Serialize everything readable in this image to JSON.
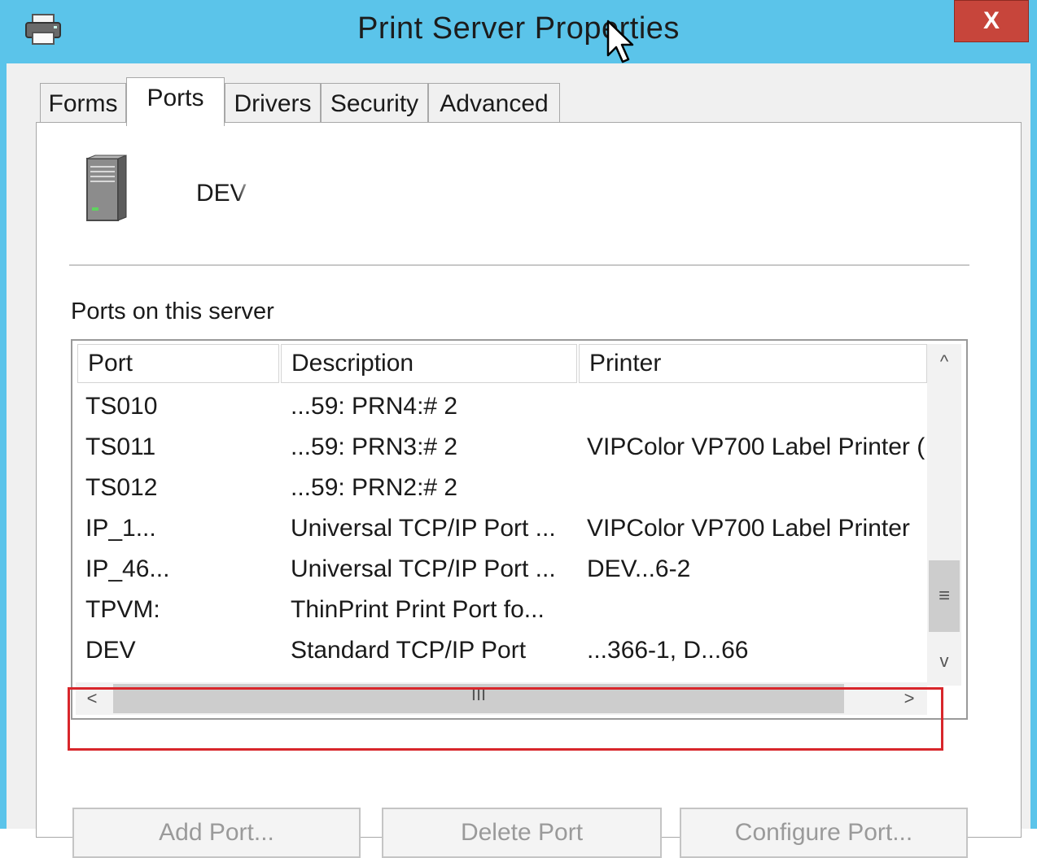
{
  "window": {
    "title": "Print Server Properties",
    "close_label": "X",
    "icon": "printer-icon"
  },
  "tabs": [
    {
      "label": "Forms",
      "active": false
    },
    {
      "label": "Ports",
      "active": true
    },
    {
      "label": "Drivers",
      "active": false
    },
    {
      "label": "Security",
      "active": false
    },
    {
      "label": "Advanced",
      "active": false
    }
  ],
  "server": {
    "icon": "server-icon",
    "name": "DEV"
  },
  "ports_section": {
    "label": "Ports on this server",
    "columns": [
      "Port",
      "Description",
      "Printer"
    ],
    "rows": [
      {
        "port": "TS010",
        "description": "...59: PRN4:# 2",
        "printer": ""
      },
      {
        "port": "TS011",
        "description": "...59: PRN3:# 2",
        "printer": "VIPColor VP700 Label Printer ("
      },
      {
        "port": "TS012",
        "description": "...59: PRN2:# 2",
        "printer": ""
      },
      {
        "port": "IP_1...",
        "description": "Universal TCP/IP Port ...",
        "printer": "VIPColor VP700 Label Printer"
      },
      {
        "port": "IP_46...",
        "description": "Universal TCP/IP Port ...",
        "printer": "DEV...6-2"
      },
      {
        "port": "TPVM:",
        "description": "ThinPrint Print Port fo...",
        "printer": ""
      },
      {
        "port": "DEV",
        "description": "Standard TCP/IP Port",
        "printer": "...366-1, D...66"
      }
    ]
  },
  "buttons": {
    "add_port": "Add Port...",
    "delete_port": "Delete Port",
    "configure_port": "Configure Port..."
  },
  "scroll": {
    "up": "^",
    "down": "v",
    "left": "<",
    "right": ">",
    "grip": "≡",
    "hgrip": "III"
  },
  "colors": {
    "title_bar": "#5bc4ea",
    "close_button": "#c7453b",
    "highlight": "#d8262b"
  }
}
